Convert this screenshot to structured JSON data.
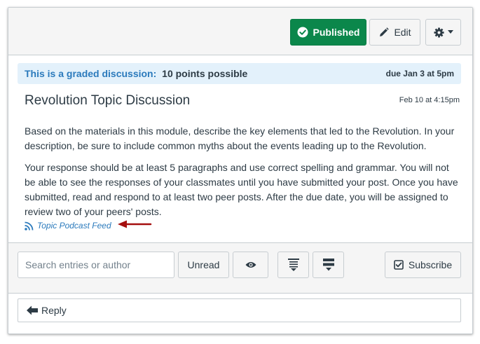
{
  "toolbar": {
    "published_label": "Published",
    "edit_label": "Edit"
  },
  "banner": {
    "graded_label": "This is a graded discussion:",
    "points": "10 points possible",
    "due": "due Jan 3 at 5pm"
  },
  "topic": {
    "title": "Revolution Topic Discussion",
    "date": "Feb 10 at 4:15pm",
    "paragraphs": [
      "Based on the materials in this module, describe the key elements that led to the Revolution. In your description, be sure to include common myths about the events leading up to the Revolution.",
      "Your response should be at least 5 paragraphs and use correct spelling and grammar. You will not be able to see the responses of your classmates until you have submitted your post. Once you have submitted, read and respond to at least two peer posts. After the due date, you will be assigned to review two of your peers' posts."
    ],
    "podcast_label": "Topic Podcast Feed"
  },
  "filters": {
    "search_placeholder": "Search entries or author",
    "unread_label": "Unread",
    "subscribe_label": "Subscribe"
  },
  "reply": {
    "label": "Reply"
  },
  "colors": {
    "published_green": "#0b874b",
    "link_blue": "#2b7abc",
    "banner_bg": "#e3f1fb",
    "annotation_arrow": "#a50f0f"
  },
  "icons": [
    "check-circle-icon",
    "pencil-icon",
    "gear-icon",
    "caret-down-icon",
    "rss-icon",
    "eye-icon",
    "collapse-icon",
    "expand-icon",
    "checkbox-icon",
    "reply-arrow-icon"
  ]
}
